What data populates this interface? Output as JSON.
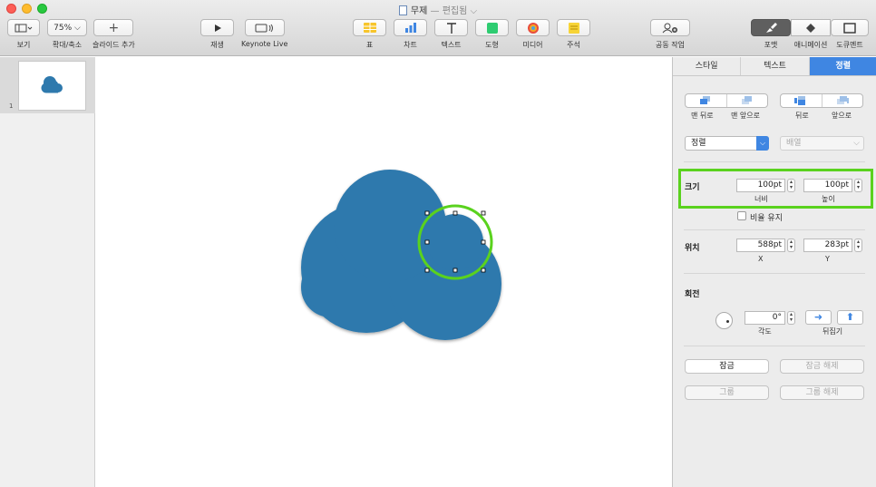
{
  "window": {
    "title": "무제",
    "title_sep": "—",
    "subtitle": "편집됨 ⌵"
  },
  "toolbar": {
    "view_label": "보기",
    "zoom_value": "75% ⌵",
    "zoom_label": "확대/축소",
    "add_slide_label": "슬라이드 추가",
    "play_label": "재생",
    "keynote_live_label": "Keynote Live",
    "table_label": "표",
    "chart_label": "차트",
    "text_label": "텍스트",
    "shape_label": "도형",
    "media_label": "미디어",
    "comment_label": "주석",
    "collaborate_label": "공동 작업",
    "format_label": "포맷",
    "animate_label": "애니메이션",
    "document_label": "도큐멘트"
  },
  "navigator": {
    "slide_number": "1"
  },
  "inspector": {
    "tabs": [
      "스타일",
      "텍스트",
      "정렬"
    ],
    "arrange": {
      "back_label": "맨 뒤로",
      "front_label": "맨 앞으로",
      "backward_label": "뒤로",
      "forward_label": "앞으로",
      "align_value": "정렬",
      "distribute_value": "배열"
    },
    "size": {
      "title": "크기",
      "width": "100pt",
      "height": "100pt",
      "width_label": "너비",
      "height_label": "높이",
      "constrain_label": "비율 유지"
    },
    "position": {
      "title": "위치",
      "x": "588pt",
      "y": "283pt",
      "x_label": "X",
      "y_label": "Y"
    },
    "rotate": {
      "title": "회전",
      "angle": "0°",
      "angle_label": "각도",
      "flip_label": "뒤집기"
    },
    "lock_label": "잠금",
    "unlock_label": "잠금 해제",
    "group_label": "그룹",
    "ungroup_label": "그룹 해제"
  },
  "colors": {
    "shape_fill": "#2e79ad",
    "highlight": "#5ad21e",
    "accent": "#3f86e2"
  }
}
